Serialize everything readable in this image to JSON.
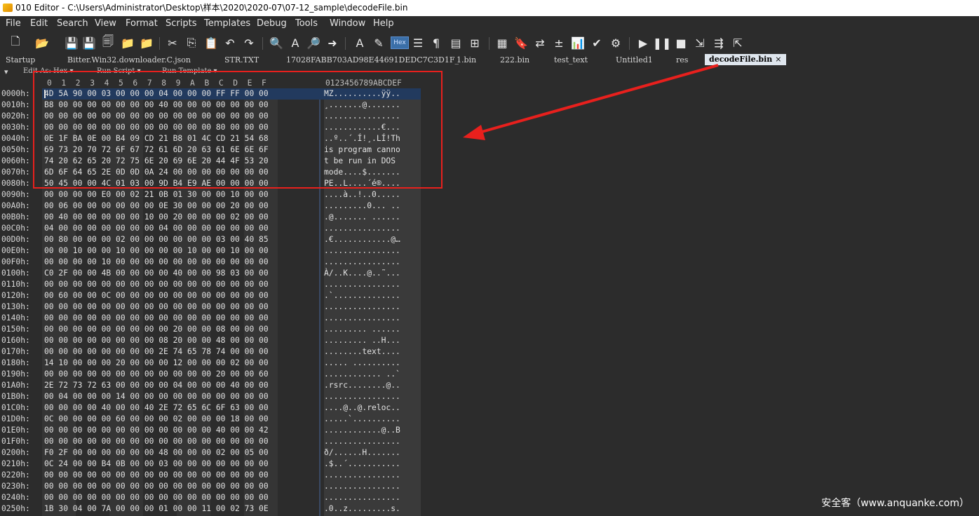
{
  "window": {
    "title": "010 Editor - C:\\Users\\Administrator\\Desktop\\样本\\2020\\2020-07\\07-12_sample\\decodeFile.bin"
  },
  "menu": [
    "File",
    "Edit",
    "Search",
    "View",
    "Format",
    "Scripts",
    "Templates",
    "Debug",
    "Tools",
    "Window",
    "Help"
  ],
  "toolbar": {
    "hex_label": "Hex"
  },
  "tabs": [
    "Startup",
    "Bitter.Win32.downloader.C.json",
    "STR.TXT",
    "17028FABB703AD98E44691DEDC7C3D1F_",
    "1.bin",
    "222.bin",
    "test_text",
    "Untitled1",
    "res"
  ],
  "active_tab": "decodeFile.bin",
  "active_tab_close": "×",
  "subbar": {
    "edit_as": "Edit As: Hex ▾",
    "run_script": "Run Script ▾",
    "run_template": "Run Template ▾"
  },
  "hex_header": "0  1  2  3  4  5  6  7  8  9  A  B  C  D  E  F",
  "ascii_header": "0123456789ABCDEF",
  "rows": [
    {
      "off": "0000h:",
      "hex": "4D 5A 90 00 03 00 00 00 04 00 00 00 FF FF 00 00",
      "asc": "MZ..........ÿÿ.."
    },
    {
      "off": "0010h:",
      "hex": "B8 00 00 00 00 00 00 00 40 00 00 00 00 00 00 00",
      "asc": "¸.......@......."
    },
    {
      "off": "0020h:",
      "hex": "00 00 00 00 00 00 00 00 00 00 00 00 00 00 00 00",
      "asc": "................"
    },
    {
      "off": "0030h:",
      "hex": "00 00 00 00 00 00 00 00 00 00 00 00 80 00 00 00",
      "asc": "............€..."
    },
    {
      "off": "0040h:",
      "hex": "0E 1F BA 0E 00 B4 09 CD 21 B8 01 4C CD 21 54 68",
      "asc": "..º..´.Í!¸.LÍ!Th"
    },
    {
      "off": "0050h:",
      "hex": "69 73 20 70 72 6F 67 72 61 6D 20 63 61 6E 6E 6F",
      "asc": "is program canno"
    },
    {
      "off": "0060h:",
      "hex": "74 20 62 65 20 72 75 6E 20 69 6E 20 44 4F 53 20",
      "asc": "t be run in DOS "
    },
    {
      "off": "0070h:",
      "hex": "6D 6F 64 65 2E 0D 0D 0A 24 00 00 00 00 00 00 00",
      "asc": "mode....$......."
    },
    {
      "off": "0080h:",
      "hex": "50 45 00 00 4C 01 03 00 9D B4 E9 AE 00 00 00 00",
      "asc": "PE..L....´é®...."
    },
    {
      "off": "0090h:",
      "hex": "00 00 00 00 E0 00 02 21 0B 01 30 00 00 10 00 00",
      "asc": "....à..!..0....."
    },
    {
      "off": "00A0h:",
      "hex": "00 06 00 00 00 00 00 00 0E 30 00 00 00 20 00 00",
      "asc": ".........0... .."
    },
    {
      "off": "00B0h:",
      "hex": "00 40 00 00 00 00 00 10 00 20 00 00 00 02 00 00",
      "asc": ".@....... ......"
    },
    {
      "off": "00C0h:",
      "hex": "04 00 00 00 00 00 00 00 04 00 00 00 00 00 00 00",
      "asc": "................"
    },
    {
      "off": "00D0h:",
      "hex": "00 80 00 00 00 02 00 00 00 00 00 00 03 00 40 85",
      "asc": ".€............@…"
    },
    {
      "off": "00E0h:",
      "hex": "00 00 10 00 00 10 00 00 00 00 10 00 00 10 00 00",
      "asc": "................"
    },
    {
      "off": "00F0h:",
      "hex": "00 00 00 00 10 00 00 00 00 00 00 00 00 00 00 00",
      "asc": "................"
    },
    {
      "off": "0100h:",
      "hex": "C0 2F 00 00 4B 00 00 00 00 40 00 00 98 03 00 00",
      "asc": "À/..K....@..˜..."
    },
    {
      "off": "0110h:",
      "hex": "00 00 00 00 00 00 00 00 00 00 00 00 00 00 00 00",
      "asc": "................"
    },
    {
      "off": "0120h:",
      "hex": "00 60 00 00 0C 00 00 00 00 00 00 00 00 00 00 00",
      "asc": ".`.............."
    },
    {
      "off": "0130h:",
      "hex": "00 00 00 00 00 00 00 00 00 00 00 00 00 00 00 00",
      "asc": "................"
    },
    {
      "off": "0140h:",
      "hex": "00 00 00 00 00 00 00 00 00 00 00 00 00 00 00 00",
      "asc": "................"
    },
    {
      "off": "0150h:",
      "hex": "00 00 00 00 00 00 00 00 00 20 00 00 08 00 00 00",
      "asc": "......... ......"
    },
    {
      "off": "0160h:",
      "hex": "00 00 00 00 00 00 00 00 08 20 00 00 48 00 00 00",
      "asc": "......... ..H..."
    },
    {
      "off": "0170h:",
      "hex": "00 00 00 00 00 00 00 00 2E 74 65 78 74 00 00 00",
      "asc": "........text...."
    },
    {
      "off": "0180h:",
      "hex": "14 10 00 00 00 20 00 00 00 12 00 00 00 02 00 00",
      "asc": "..... .........."
    },
    {
      "off": "0190h:",
      "hex": "00 00 00 00 00 00 00 00 00 00 00 00 20 00 00 60",
      "asc": "............ ..`"
    },
    {
      "off": "01A0h:",
      "hex": "2E 72 73 72 63 00 00 00 00 04 00 00 00 40 00 00",
      "asc": ".rsrc........@.."
    },
    {
      "off": "01B0h:",
      "hex": "00 04 00 00 00 14 00 00 00 00 00 00 00 00 00 00",
      "asc": "................"
    },
    {
      "off": "01C0h:",
      "hex": "00 00 00 00 40 00 00 40 2E 72 65 6C 6F 63 00 00",
      "asc": "....@..@.reloc.."
    },
    {
      "off": "01D0h:",
      "hex": "0C 00 00 00 00 60 00 00 00 02 00 00 00 18 00 00",
      "asc": ".....`.........."
    },
    {
      "off": "01E0h:",
      "hex": "00 00 00 00 00 00 00 00 00 00 00 00 40 00 00 42",
      "asc": "............@..B"
    },
    {
      "off": "01F0h:",
      "hex": "00 00 00 00 00 00 00 00 00 00 00 00 00 00 00 00",
      "asc": "................"
    },
    {
      "off": "0200h:",
      "hex": "F0 2F 00 00 00 00 00 00 48 00 00 00 02 00 05 00",
      "asc": "ð/......H......."
    },
    {
      "off": "0210h:",
      "hex": "0C 24 00 00 B4 0B 00 00 03 00 00 00 00 00 00 00",
      "asc": ".$..´..........."
    },
    {
      "off": "0220h:",
      "hex": "00 00 00 00 00 00 00 00 00 00 00 00 00 00 00 00",
      "asc": "................"
    },
    {
      "off": "0230h:",
      "hex": "00 00 00 00 00 00 00 00 00 00 00 00 00 00 00 00",
      "asc": "................"
    },
    {
      "off": "0240h:",
      "hex": "00 00 00 00 00 00 00 00 00 00 00 00 00 00 00 00",
      "asc": "................"
    },
    {
      "off": "0250h:",
      "hex": "1B 30 04 00 7A 00 00 00 01 00 00 11 00 02 73 0E",
      "asc": ".0..z.........s."
    }
  ],
  "watermark": "安全客（www.anquanke.com）",
  "colors": {
    "annotation": "#e8201d",
    "selection": "#223a5e",
    "background": "#2c2c2c"
  }
}
